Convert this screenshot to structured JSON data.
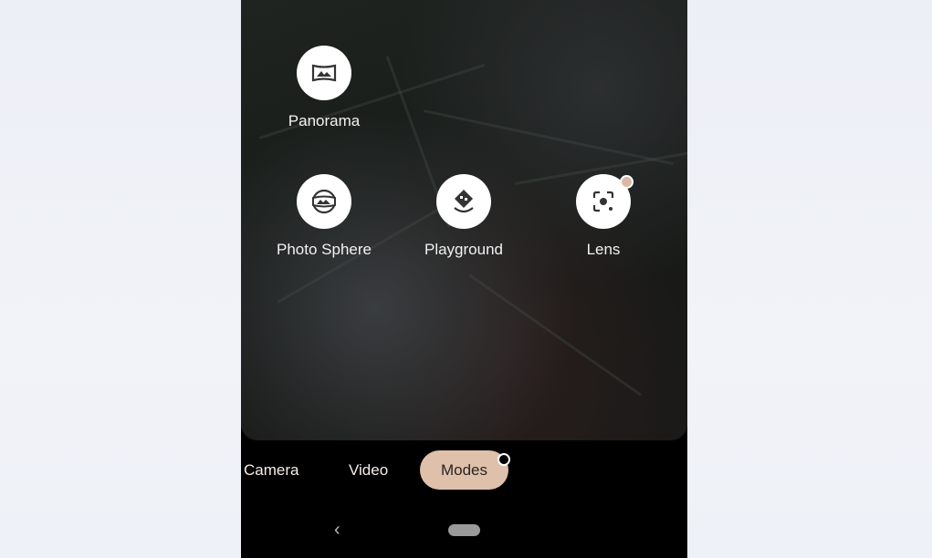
{
  "modes": [
    {
      "label": "Panorama",
      "icon": "panorama-icon"
    },
    {
      "label": "Photo Sphere",
      "icon": "photo-sphere-icon"
    },
    {
      "label": "Playground",
      "icon": "playground-icon"
    },
    {
      "label": "Lens",
      "icon": "lens-icon",
      "has_badge": true
    }
  ],
  "tabs": [
    {
      "label": "Camera"
    },
    {
      "label": "Video"
    },
    {
      "label": "Modes",
      "active": true
    }
  ],
  "colors": {
    "accent": "#dfc0aa",
    "badge": "#dcb9a6"
  },
  "nav": {
    "back_icon": "chevron-left-icon",
    "home_icon": "home-pill-icon"
  }
}
